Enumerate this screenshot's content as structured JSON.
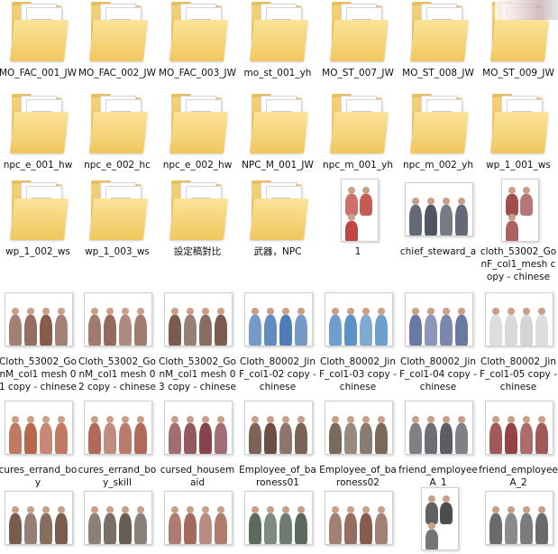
{
  "files": [
    {
      "label": "MO_FAC_001_JW",
      "type": "folder"
    },
    {
      "label": "MO_FAC_002_JW",
      "type": "folder"
    },
    {
      "label": "MO_FAC_003_JW",
      "type": "folder"
    },
    {
      "label": "mo_st_001_yh",
      "type": "folder"
    },
    {
      "label": "MO_ST_007_JW",
      "type": "folder"
    },
    {
      "label": "MO_ST_008_JW",
      "type": "folder"
    },
    {
      "label": "MO_ST_009_JW",
      "type": "folder"
    },
    {
      "label": "npc_e_001_hw",
      "type": "folder"
    },
    {
      "label": "npc_e_002_hc",
      "type": "folder"
    },
    {
      "label": "npc_e_002_hw",
      "type": "folder"
    },
    {
      "label": "NPC_M_001_JW",
      "type": "folder"
    },
    {
      "label": "npc_m_001_yh",
      "type": "folder"
    },
    {
      "label": "npc_m_002_yh",
      "type": "folder"
    },
    {
      "label": "wp_1_001_ws",
      "type": "folder"
    },
    {
      "label": "wp_1_002_ws",
      "type": "folder"
    },
    {
      "label": "wp_1_003_ws",
      "type": "folder"
    },
    {
      "label": "設定稿對比",
      "type": "folder"
    },
    {
      "label": "武器，NPC",
      "type": "folder"
    },
    {
      "label": "1",
      "type": "image",
      "accent": "#b8322c",
      "tall": true
    },
    {
      "label": "chief_steward_a",
      "type": "image",
      "accent": "#3c4452"
    },
    {
      "label": "cloth_53002_GonF_col1_mesh copy - chinese",
      "type": "image",
      "accent": "#9a3a3a",
      "tall": true
    },
    {
      "label": "Cloth_53002_GonM_col1 mesh 01 copy - chinese",
      "type": "image",
      "accent": "#7a4a3a"
    },
    {
      "label": "Cloth_53002_GonM_col1 mesh 02 copy - chinese",
      "type": "image",
      "accent": "#8a5a4a"
    },
    {
      "label": "Cloth_53002_GonM_col1 mesh 03 copy - chinese",
      "type": "image",
      "accent": "#6a4a3a"
    },
    {
      "label": "Cloth_80002_JinF_col1-02 copy - chinese",
      "type": "image",
      "accent": "#3b6fb0"
    },
    {
      "label": "Cloth_80002_JinF_col1-03 copy - chinese",
      "type": "image",
      "accent": "#4a86c0"
    },
    {
      "label": "Cloth_80002_JinF_col1-04 copy - chinese",
      "type": "image",
      "accent": "#5a6a9a"
    },
    {
      "label": "Cloth_80002_JinF_col1-05 copy - chinese",
      "type": "image",
      "accent": "#cfcfcf"
    },
    {
      "label": "cures_errand_boy",
      "type": "image",
      "accent": "#b0563a"
    },
    {
      "label": "cures_errand_boy_skill",
      "type": "image",
      "accent": "#a85a48"
    },
    {
      "label": "cursed_housemaid",
      "type": "image",
      "accent": "#7a2e38"
    },
    {
      "label": "Employee_of_baroness01",
      "type": "image",
      "accent": "#5c3b2e"
    },
    {
      "label": "Employee_of_baroness02",
      "type": "image",
      "accent": "#6b5a4a"
    },
    {
      "label": "friend_employeeA_1",
      "type": "image",
      "accent": "#4a4a52"
    },
    {
      "label": "friend_employeeA_2",
      "type": "image",
      "accent": "#8a2e2e"
    },
    {
      "label": "",
      "type": "image",
      "accent": "#6a4a3a"
    },
    {
      "label": "",
      "type": "image",
      "accent": "#5a4a40"
    },
    {
      "label": "",
      "type": "image",
      "accent": "#9a5a4a"
    },
    {
      "label": "",
      "type": "image",
      "accent": "#4a5a4a"
    },
    {
      "label": "",
      "type": "image",
      "accent": "#7a4a3a"
    },
    {
      "label": "",
      "type": "image",
      "accent": "#3a3a3a",
      "tall": true
    },
    {
      "label": "",
      "type": "image",
      "accent": "#5a5a5a"
    }
  ]
}
